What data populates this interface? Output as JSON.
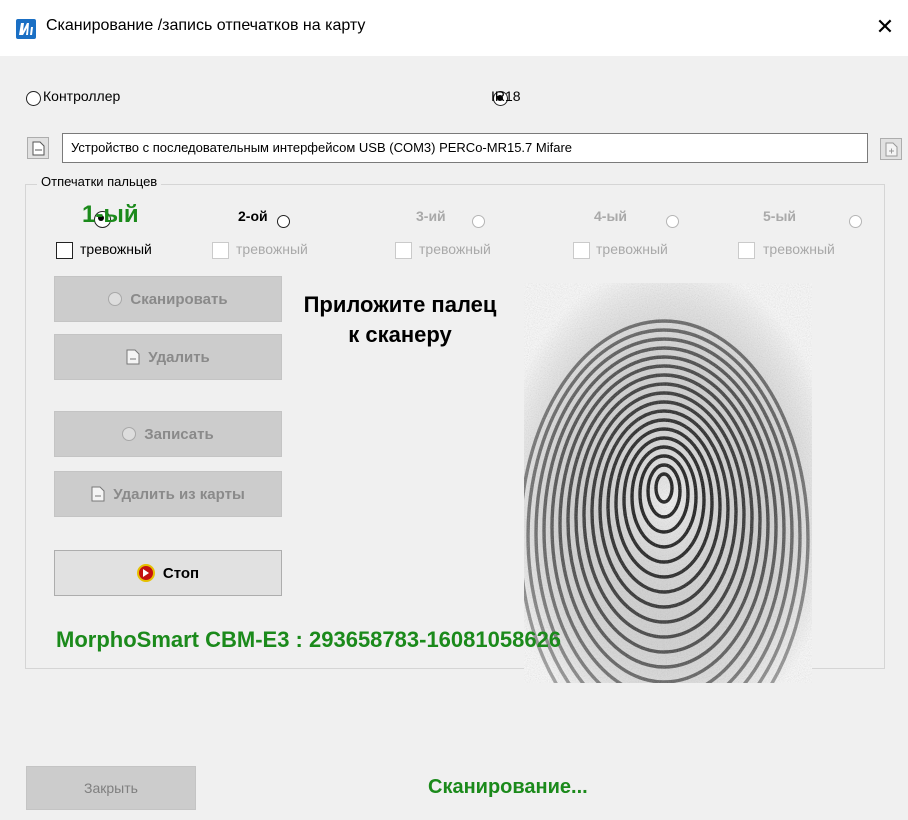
{
  "window": {
    "title": "Сканирование /запись отпечатков на карту",
    "close_glyph": "✕"
  },
  "source": {
    "options": [
      {
        "label": "Контроллер",
        "selected": false
      },
      {
        "label": "IR18",
        "selected": true
      }
    ]
  },
  "device": {
    "value": "Устройство с последовательным интерфейсом USB (COM3) PERCo-MR15.7 Mifare"
  },
  "fingerprints": {
    "group_title": "Отпечатки пальцев",
    "fingers": [
      {
        "label": "1-ый",
        "selected": true,
        "enabled": true,
        "alarm_label": "тревожный",
        "alarm_checked": false,
        "alarm_enabled": true
      },
      {
        "label": "2-ой",
        "selected": false,
        "enabled": true,
        "alarm_label": "тревожный",
        "alarm_checked": false,
        "alarm_enabled": false
      },
      {
        "label": "3-ий",
        "selected": false,
        "enabled": false,
        "alarm_label": "тревожный",
        "alarm_checked": false,
        "alarm_enabled": false
      },
      {
        "label": "4-ый",
        "selected": false,
        "enabled": false,
        "alarm_label": "тревожный",
        "alarm_checked": false,
        "alarm_enabled": false
      },
      {
        "label": "5-ый",
        "selected": false,
        "enabled": false,
        "alarm_label": "тревожный",
        "alarm_checked": false,
        "alarm_enabled": false
      }
    ]
  },
  "actions": {
    "scan": "Сканировать",
    "delete": "Удалить",
    "write": "Записать",
    "delete_from_card": "Удалить из карты",
    "stop": "Стоп"
  },
  "prompt": "Приложите палец к сканеру",
  "scanner_info": "MorphoSmart CBM-E3 : 293658783-16081058626",
  "footer": {
    "close": "Закрыть",
    "status": "Сканирование..."
  },
  "colors": {
    "accent_green": "#1b8a1b",
    "disabled_button": "#cccccc"
  }
}
